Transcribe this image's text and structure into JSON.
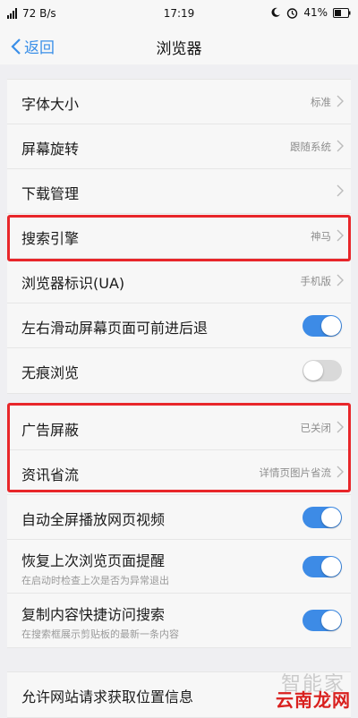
{
  "status": {
    "signal_text": "72 B/s",
    "time": "17:19",
    "battery": "41%"
  },
  "nav": {
    "back_label": "返回",
    "title": "浏览器"
  },
  "group1": [
    {
      "label": "字体大小",
      "value": "标准"
    },
    {
      "label": "屏幕旋转",
      "value": "跟随系统"
    },
    {
      "label": "下载管理",
      "value": ""
    },
    {
      "label": "搜索引擎",
      "value": "神马"
    },
    {
      "label": "浏览器标识(UA)",
      "value": "手机版"
    },
    {
      "label": "左右滑动屏幕页面可前进后退",
      "toggle": true
    },
    {
      "label": "无痕浏览",
      "toggle": false
    }
  ],
  "group2": [
    {
      "label": "广告屏蔽",
      "value": "已关闭"
    },
    {
      "label": "资讯省流",
      "value": "详情页图片省流"
    },
    {
      "label": "自动全屏播放网页视频",
      "toggle": true
    },
    {
      "label": "恢复上次浏览页面提醒",
      "sub": "在启动时检查上次是否为异常退出",
      "toggle": true
    },
    {
      "label": "复制内容快捷访问搜索",
      "sub": "在搜索框展示剪贴板的最新一条内容",
      "toggle": true
    }
  ],
  "group3": [
    {
      "label": "允许网站请求获取位置信息"
    }
  ],
  "colors": {
    "accent": "#3d8be6",
    "highlight": "#e8262a",
    "background": "#efeff2"
  },
  "watermark": {
    "top": "智能家",
    "bottom": "云南龙网"
  }
}
